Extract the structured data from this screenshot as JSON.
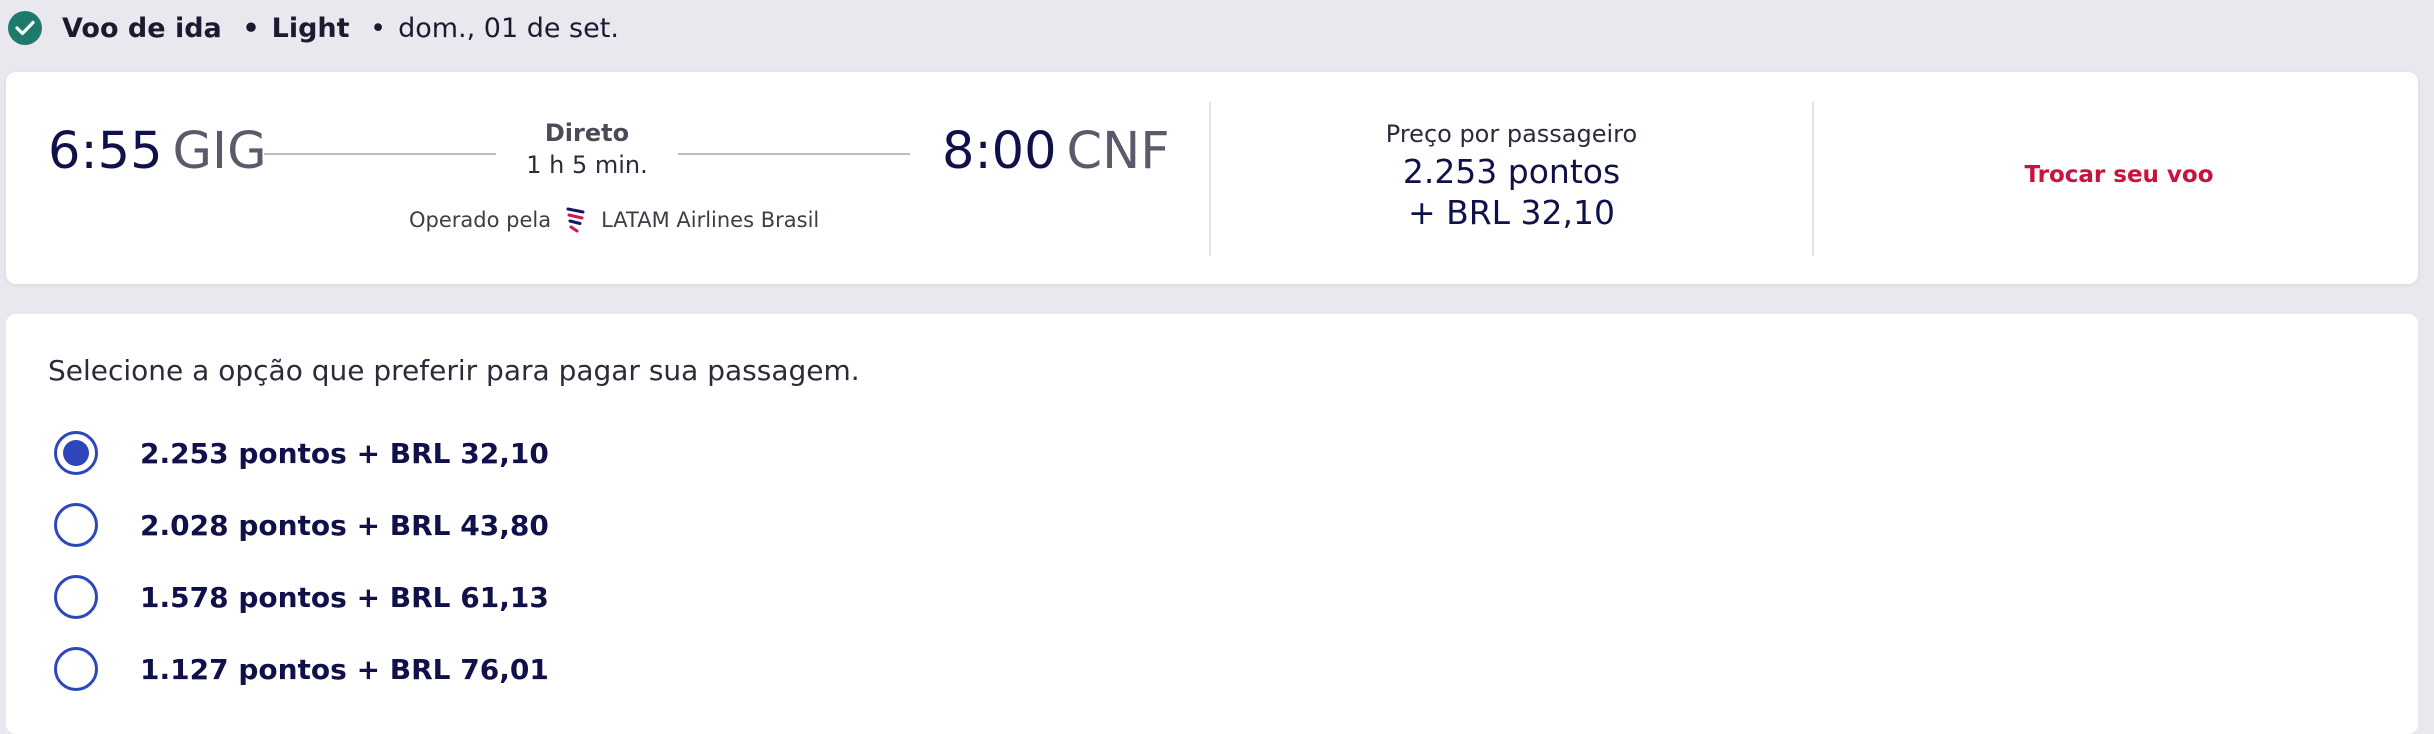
{
  "header": {
    "flight_type": "Voo de ida",
    "separator": "•",
    "fare": "Light",
    "date": "dom., 01 de set."
  },
  "flight": {
    "departure_time": "6:55",
    "departure_airport": "GIG",
    "arrival_time": "8:00",
    "arrival_airport": "CNF",
    "stops_label": "Direto",
    "duration": "1 h 5 min.",
    "operated_by_label": "Operado pela",
    "airline": "LATAM Airlines Brasil"
  },
  "price": {
    "label": "Preço por passageiro",
    "points": "2.253 pontos",
    "cash": "+ BRL 32,10"
  },
  "actions": {
    "change_flight": "Trocar seu voo"
  },
  "payment": {
    "title": "Selecione a opção que preferir para pagar sua passagem.",
    "options": [
      {
        "label": "2.253 pontos + BRL 32,10",
        "selected": true
      },
      {
        "label": "2.028 pontos + BRL 43,80",
        "selected": false
      },
      {
        "label": "1.578 pontos + BRL 61,13",
        "selected": false
      },
      {
        "label": "1.127 pontos + BRL 76,01",
        "selected": false
      }
    ]
  },
  "colors": {
    "check": "#1d7a6c",
    "accent": "#c9123f",
    "radio": "#2d46b9",
    "text_dark": "#10114a"
  },
  "icons": {
    "status": "check-circle-icon",
    "airline_logo": "latam-logo-icon"
  }
}
